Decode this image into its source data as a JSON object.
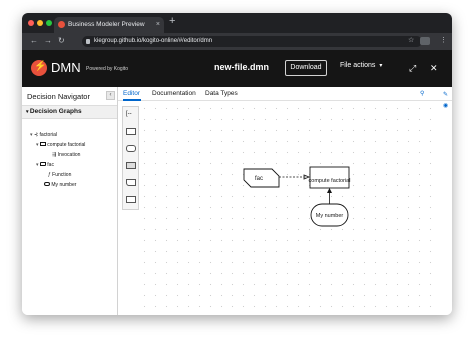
{
  "browser": {
    "tab_title": "Business Modeler Preview",
    "tab_close": "×",
    "new_tab": "+",
    "url": "kiegroup.github.io/kogito-online/#/editor/dmn",
    "nav_back": "←",
    "nav_forward": "→",
    "nav_reload": "↻",
    "star": "☆",
    "menu_dots": "⋮"
  },
  "app": {
    "name": "DMN",
    "powered_by": "Powered by Kogito",
    "filename": "new-file.dmn",
    "download_label": "Download",
    "file_actions_label": "File actions",
    "file_actions_caret": "▾",
    "fullscreen_icon": "⤢",
    "close_icon": "✕"
  },
  "navigator": {
    "title": "Decision Navigator",
    "collapse": "‹",
    "section": "Decision Graphs",
    "items": [
      {
        "label": "factorial"
      },
      {
        "label": "compute factorial"
      },
      {
        "label": "Invocation"
      },
      {
        "label": "fac"
      },
      {
        "label": "Function"
      },
      {
        "label": "My number"
      }
    ]
  },
  "editor": {
    "tabs": [
      {
        "label": "Editor"
      },
      {
        "label": "Documentation"
      },
      {
        "label": "Data Types"
      }
    ],
    "nodes": {
      "bkm": "fac",
      "decision": "compute factorial",
      "input": "My number"
    }
  },
  "colors": {
    "brand": "#e8513c",
    "accent": "#0066cc",
    "app_bar": "#151515"
  }
}
